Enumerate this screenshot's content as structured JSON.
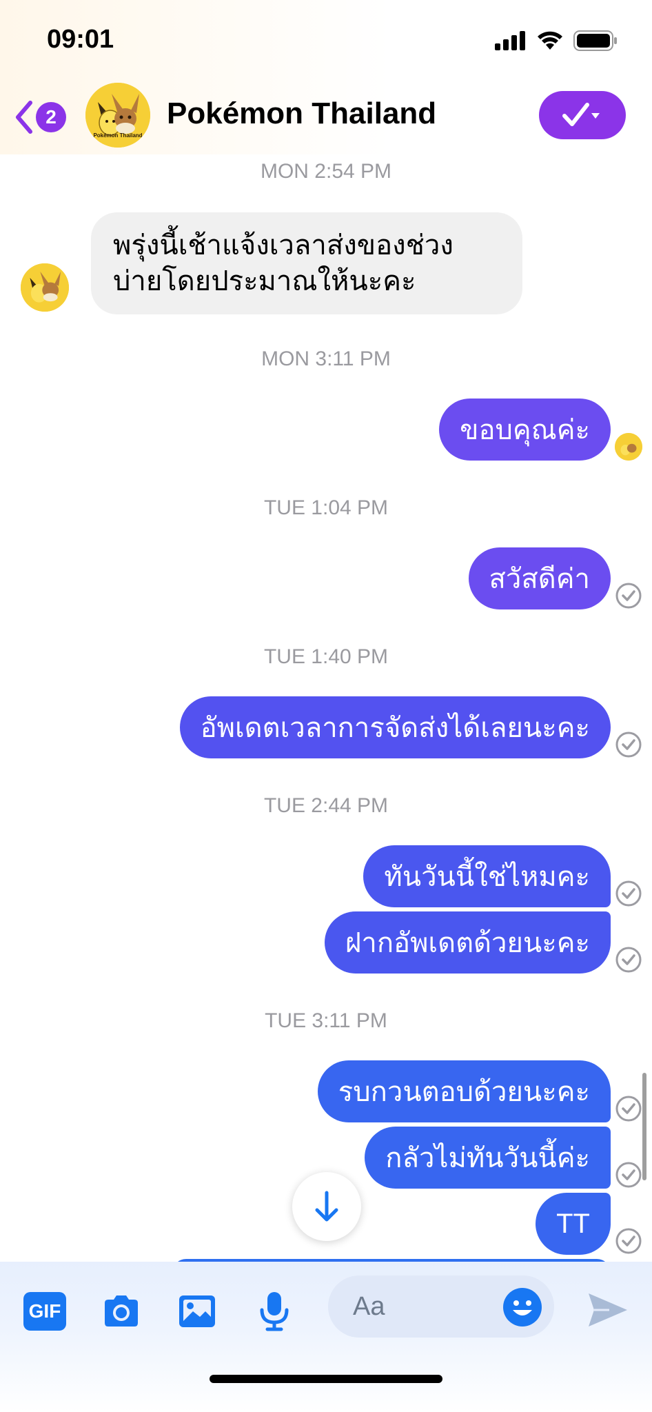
{
  "status_bar": {
    "time": "09:01"
  },
  "header": {
    "title": "Pokémon Thailand",
    "unread_count": "2",
    "avatar_caption": "Pokémon Thailand"
  },
  "messages": [
    {
      "type": "timestamp",
      "text": "MON 2:54 PM"
    },
    {
      "type": "incoming",
      "text": "พรุ่งนี้เช้าแจ้งเวลาส่งของช่วงบ่ายโดยประมาณให้นะคะ"
    },
    {
      "type": "timestamp",
      "text": "MON 3:11 PM"
    },
    {
      "type": "outgoing",
      "text": "ขอบคุณค่ะ",
      "status": "seen",
      "color": "#6b4df0"
    },
    {
      "type": "timestamp",
      "text": "TUE 1:04 PM"
    },
    {
      "type": "outgoing",
      "text": "สวัสดีค่า",
      "status": "delivered",
      "color": "#6b4df0"
    },
    {
      "type": "timestamp",
      "text": "TUE 1:40 PM"
    },
    {
      "type": "outgoing",
      "text": "อัพเดตเวลาการจัดส่งได้เลยนะคะ",
      "status": "delivered",
      "color": "#5352f0"
    },
    {
      "type": "timestamp",
      "text": "TUE 2:44 PM"
    },
    {
      "type": "outgoing",
      "text": "ทันวันนี้ใช่ไหมคะ",
      "status": "delivered",
      "color": "#4a57ef"
    },
    {
      "type": "outgoing",
      "text": "ฝากอัพเดตด้วยนะคะ",
      "status": "delivered",
      "color": "#4a57ef"
    },
    {
      "type": "timestamp",
      "text": "TUE 3:11 PM"
    },
    {
      "type": "outgoing",
      "text": "รบกวนตอบด้วยนะคะ",
      "status": "delivered",
      "color": "#3866f0"
    },
    {
      "type": "outgoing",
      "text": "กลัวไม่ทันวันนี้ค่ะ",
      "status": "delivered",
      "color": "#3866f0"
    },
    {
      "type": "outgoing",
      "text": "TT",
      "status": "delivered",
      "color": "#3866f0"
    }
  ],
  "composer": {
    "gif_label": "GIF",
    "placeholder": "Aa",
    "icons": [
      "gif-icon",
      "camera-icon",
      "photo-icon",
      "microphone-icon",
      "emoji-icon",
      "send-icon"
    ]
  },
  "colors": {
    "accent": "#8b34e8",
    "messenger_blue": "#1877f2",
    "timestamp": "#9a9a9f"
  }
}
